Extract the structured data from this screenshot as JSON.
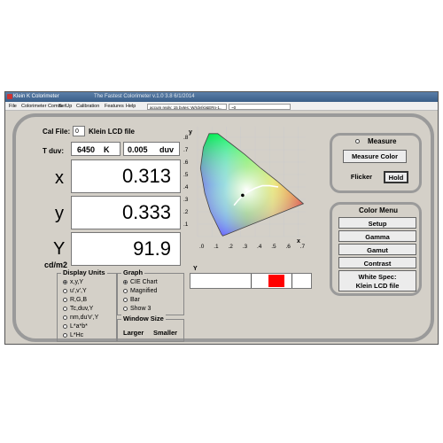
{
  "window": {
    "title": "Klein K Colorimeter",
    "subtitle": "The Fastest Colorimeter v.1.0     3.8 6/1/2014",
    "menu": [
      "File",
      "Colorimeter Comm",
      "SetUp",
      "Calibration",
      "Features",
      "Help"
    ],
    "status_reply": "accum reply: 15 bytes: W/rdy(k)&ERn-1..",
    "status_value": "~0"
  },
  "cal": {
    "label": "Cal File:",
    "number": "0",
    "file_name": "Klein LCD file"
  },
  "tduv": {
    "label": "T duv:",
    "temp_value": "6450",
    "temp_unit": "K",
    "duv_value": "0.005",
    "duv_unit": "duv"
  },
  "readings": [
    {
      "label": "x",
      "value": "0.313"
    },
    {
      "label": "y",
      "value": "0.333"
    },
    {
      "label": "Y",
      "value": "91.9"
    }
  ],
  "unit_label": "cd/m2",
  "display_units": {
    "title": "Display Units",
    "options": [
      "x,y,Y",
      "u',v',Y",
      "R,G,B",
      "Tc,duv,Y",
      "nm,du'v',Y",
      "L*a*b*",
      "L*Hc"
    ],
    "selected": 0
  },
  "graph": {
    "title": "Graph",
    "options": [
      "CIE Chart",
      "Magnified",
      "Bar",
      "Show 3"
    ],
    "selected": 0
  },
  "window_size": {
    "title": "Window Size",
    "larger": "Larger",
    "smaller": "Smaller"
  },
  "chart_data": {
    "type": "scatter",
    "title": "",
    "xlabel": "x",
    "ylabel": "y",
    "xlim": [
      0,
      0.8
    ],
    "ylim": [
      0,
      0.9
    ],
    "x_ticks": [
      ".0",
      ".1",
      ".2",
      ".3",
      ".4",
      ".5",
      ".6",
      ".7"
    ],
    "y_ticks": [
      ".1",
      ".2",
      ".3",
      ".4",
      ".5",
      ".6",
      ".7",
      ".8"
    ],
    "grid": true,
    "points": [
      {
        "x": 0.313,
        "y": 0.333
      }
    ]
  },
  "bar": {
    "label": "Y",
    "level": 0.5
  },
  "measure_panel": {
    "title": "Measure",
    "measure_color": "Measure Color",
    "flicker": "Flicker",
    "hold": "Hold"
  },
  "color_menu": {
    "title": "Color Menu",
    "items": [
      "Setup",
      "Gamma",
      "Gamut",
      "Contrast"
    ],
    "white_spec_line1": "White Spec:",
    "white_spec_line2": "Klein LCD file"
  }
}
